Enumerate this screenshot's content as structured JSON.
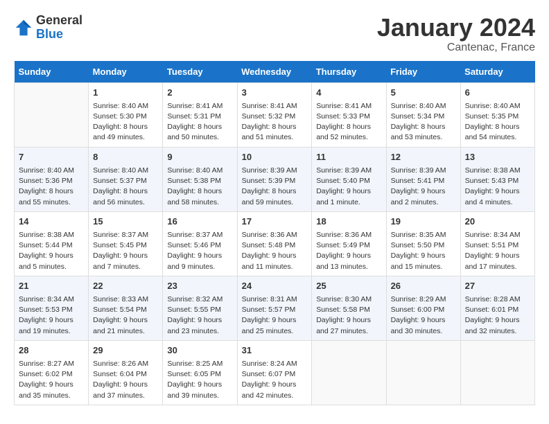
{
  "header": {
    "logo_general": "General",
    "logo_blue": "Blue",
    "month_year": "January 2024",
    "location": "Cantenac, France"
  },
  "days_of_week": [
    "Sunday",
    "Monday",
    "Tuesday",
    "Wednesday",
    "Thursday",
    "Friday",
    "Saturday"
  ],
  "weeks": [
    [
      {
        "day": "",
        "info": ""
      },
      {
        "day": "1",
        "info": "Sunrise: 8:40 AM\nSunset: 5:30 PM\nDaylight: 8 hours\nand 49 minutes."
      },
      {
        "day": "2",
        "info": "Sunrise: 8:41 AM\nSunset: 5:31 PM\nDaylight: 8 hours\nand 50 minutes."
      },
      {
        "day": "3",
        "info": "Sunrise: 8:41 AM\nSunset: 5:32 PM\nDaylight: 8 hours\nand 51 minutes."
      },
      {
        "day": "4",
        "info": "Sunrise: 8:41 AM\nSunset: 5:33 PM\nDaylight: 8 hours\nand 52 minutes."
      },
      {
        "day": "5",
        "info": "Sunrise: 8:40 AM\nSunset: 5:34 PM\nDaylight: 8 hours\nand 53 minutes."
      },
      {
        "day": "6",
        "info": "Sunrise: 8:40 AM\nSunset: 5:35 PM\nDaylight: 8 hours\nand 54 minutes."
      }
    ],
    [
      {
        "day": "7",
        "info": "Sunrise: 8:40 AM\nSunset: 5:36 PM\nDaylight: 8 hours\nand 55 minutes."
      },
      {
        "day": "8",
        "info": "Sunrise: 8:40 AM\nSunset: 5:37 PM\nDaylight: 8 hours\nand 56 minutes."
      },
      {
        "day": "9",
        "info": "Sunrise: 8:40 AM\nSunset: 5:38 PM\nDaylight: 8 hours\nand 58 minutes."
      },
      {
        "day": "10",
        "info": "Sunrise: 8:39 AM\nSunset: 5:39 PM\nDaylight: 8 hours\nand 59 minutes."
      },
      {
        "day": "11",
        "info": "Sunrise: 8:39 AM\nSunset: 5:40 PM\nDaylight: 9 hours\nand 1 minute."
      },
      {
        "day": "12",
        "info": "Sunrise: 8:39 AM\nSunset: 5:41 PM\nDaylight: 9 hours\nand 2 minutes."
      },
      {
        "day": "13",
        "info": "Sunrise: 8:38 AM\nSunset: 5:43 PM\nDaylight: 9 hours\nand 4 minutes."
      }
    ],
    [
      {
        "day": "14",
        "info": "Sunrise: 8:38 AM\nSunset: 5:44 PM\nDaylight: 9 hours\nand 5 minutes."
      },
      {
        "day": "15",
        "info": "Sunrise: 8:37 AM\nSunset: 5:45 PM\nDaylight: 9 hours\nand 7 minutes."
      },
      {
        "day": "16",
        "info": "Sunrise: 8:37 AM\nSunset: 5:46 PM\nDaylight: 9 hours\nand 9 minutes."
      },
      {
        "day": "17",
        "info": "Sunrise: 8:36 AM\nSunset: 5:48 PM\nDaylight: 9 hours\nand 11 minutes."
      },
      {
        "day": "18",
        "info": "Sunrise: 8:36 AM\nSunset: 5:49 PM\nDaylight: 9 hours\nand 13 minutes."
      },
      {
        "day": "19",
        "info": "Sunrise: 8:35 AM\nSunset: 5:50 PM\nDaylight: 9 hours\nand 15 minutes."
      },
      {
        "day": "20",
        "info": "Sunrise: 8:34 AM\nSunset: 5:51 PM\nDaylight: 9 hours\nand 17 minutes."
      }
    ],
    [
      {
        "day": "21",
        "info": "Sunrise: 8:34 AM\nSunset: 5:53 PM\nDaylight: 9 hours\nand 19 minutes."
      },
      {
        "day": "22",
        "info": "Sunrise: 8:33 AM\nSunset: 5:54 PM\nDaylight: 9 hours\nand 21 minutes."
      },
      {
        "day": "23",
        "info": "Sunrise: 8:32 AM\nSunset: 5:55 PM\nDaylight: 9 hours\nand 23 minutes."
      },
      {
        "day": "24",
        "info": "Sunrise: 8:31 AM\nSunset: 5:57 PM\nDaylight: 9 hours\nand 25 minutes."
      },
      {
        "day": "25",
        "info": "Sunrise: 8:30 AM\nSunset: 5:58 PM\nDaylight: 9 hours\nand 27 minutes."
      },
      {
        "day": "26",
        "info": "Sunrise: 8:29 AM\nSunset: 6:00 PM\nDaylight: 9 hours\nand 30 minutes."
      },
      {
        "day": "27",
        "info": "Sunrise: 8:28 AM\nSunset: 6:01 PM\nDaylight: 9 hours\nand 32 minutes."
      }
    ],
    [
      {
        "day": "28",
        "info": "Sunrise: 8:27 AM\nSunset: 6:02 PM\nDaylight: 9 hours\nand 35 minutes."
      },
      {
        "day": "29",
        "info": "Sunrise: 8:26 AM\nSunset: 6:04 PM\nDaylight: 9 hours\nand 37 minutes."
      },
      {
        "day": "30",
        "info": "Sunrise: 8:25 AM\nSunset: 6:05 PM\nDaylight: 9 hours\nand 39 minutes."
      },
      {
        "day": "31",
        "info": "Sunrise: 8:24 AM\nSunset: 6:07 PM\nDaylight: 9 hours\nand 42 minutes."
      },
      {
        "day": "",
        "info": ""
      },
      {
        "day": "",
        "info": ""
      },
      {
        "day": "",
        "info": ""
      }
    ]
  ]
}
